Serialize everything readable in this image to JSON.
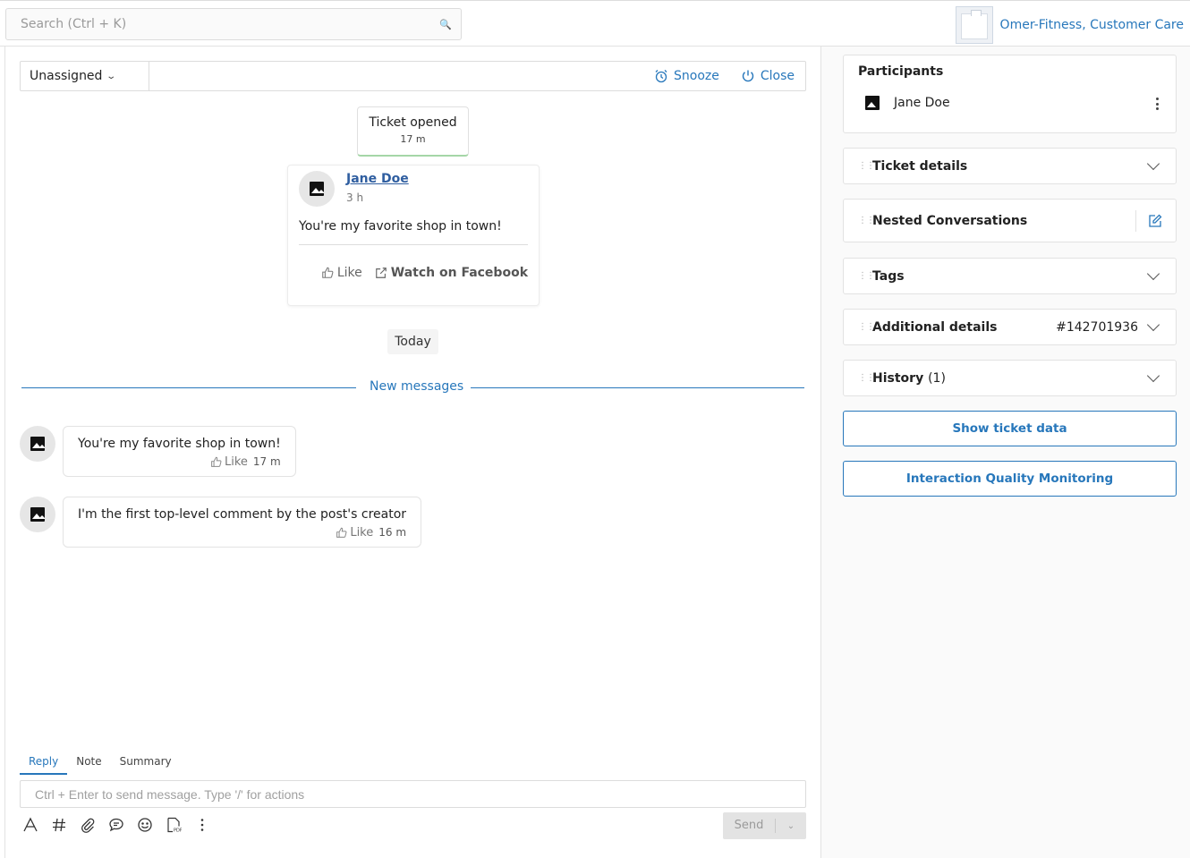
{
  "header": {
    "search_placeholder": "Search (Ctrl + K)",
    "brand_name": "Omer-Fitness, Customer Care"
  },
  "action_bar": {
    "assignee": "Unassigned",
    "snooze_label": "Snooze",
    "close_label": "Close"
  },
  "conversation": {
    "ticket_opened": {
      "label": "Ticket opened",
      "time": "17 m"
    },
    "post": {
      "author": "Jane Doe",
      "time": "3 h",
      "text": "You're my favorite shop in town!",
      "like_label": "Like",
      "watch_label": "Watch on Facebook"
    },
    "date_separator": "Today",
    "new_messages_label": "New messages",
    "messages": [
      {
        "text": "You're my favorite shop in town!",
        "like_label": "Like",
        "time": "17 m"
      },
      {
        "text": "I'm the first top-level comment by the post's creator",
        "like_label": "Like",
        "time": "16 m"
      }
    ]
  },
  "composer": {
    "tabs": [
      "Reply",
      "Note",
      "Summary"
    ],
    "active_tab": "Reply",
    "placeholder": "Ctrl + Enter to send message. Type '/' for actions",
    "send_label": "Send",
    "toolbar_icons": [
      "text-format-icon",
      "hashtag-icon",
      "attachment-icon",
      "canned-response-icon",
      "emoji-icon",
      "pdf-icon",
      "more-vertical-icon"
    ]
  },
  "sidebar": {
    "participants": {
      "title": "Participants",
      "items": [
        {
          "name": "Jane Doe"
        }
      ]
    },
    "sections": [
      {
        "title": "Ticket details"
      },
      {
        "title": "Nested Conversations"
      },
      {
        "title": "Tags"
      },
      {
        "title": "Additional details",
        "value": "#142701936"
      },
      {
        "title": "History",
        "count": "(1)"
      }
    ],
    "buttons": {
      "show_ticket_data": "Show ticket data",
      "quality_monitoring": "Interaction Quality Monitoring"
    }
  },
  "colors": {
    "accent": "#2777bb",
    "ticket_opened_border": "#a5d6a7",
    "send_disabled_bg": "#e3e3e3"
  }
}
